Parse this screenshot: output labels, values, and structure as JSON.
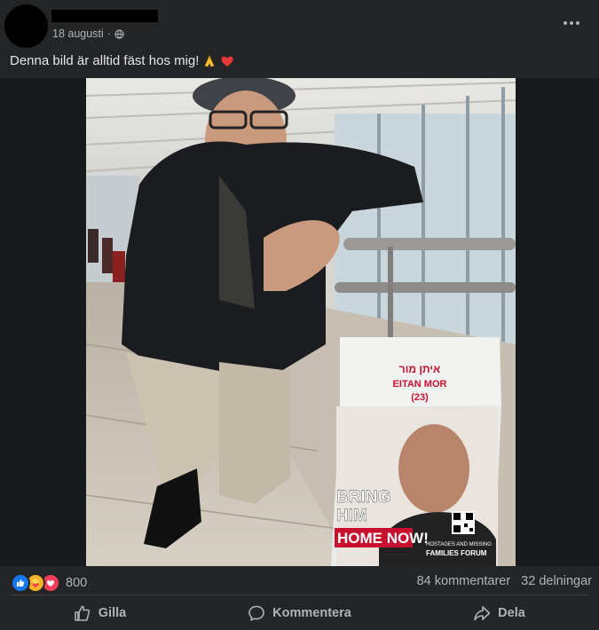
{
  "post": {
    "date": "18 augusti",
    "separator": "·",
    "caption": "Denna bild är alltid fäst hos mig!",
    "caption_emojis": [
      "folded-hands",
      "red-heart"
    ]
  },
  "photo": {
    "sign_hebrew": "איתן מור",
    "sign_name": "EITAN MOR",
    "sign_age": "(23)",
    "sign_line1": "BRING",
    "sign_line2": "HIM",
    "sign_line3": "HOME NOW!",
    "sign_org_line1": "HOSTAGES AND MISSING",
    "sign_org_line2": "FAMILIES FORUM"
  },
  "stats": {
    "reaction_icons": [
      "like-icon",
      "care-icon",
      "love-icon"
    ],
    "reaction_count": "800",
    "comments": "84 kommentarer",
    "shares": "32 delningar"
  },
  "actions": {
    "like": "Gilla",
    "comment": "Kommentera",
    "share": "Dela"
  },
  "colors": {
    "background": "#242526",
    "text_primary": "#e4e6eb",
    "text_secondary": "#b0b3b8",
    "like_blue": "#1877f2",
    "love_red": "#f33e58",
    "sign_red": "#c8102e"
  }
}
